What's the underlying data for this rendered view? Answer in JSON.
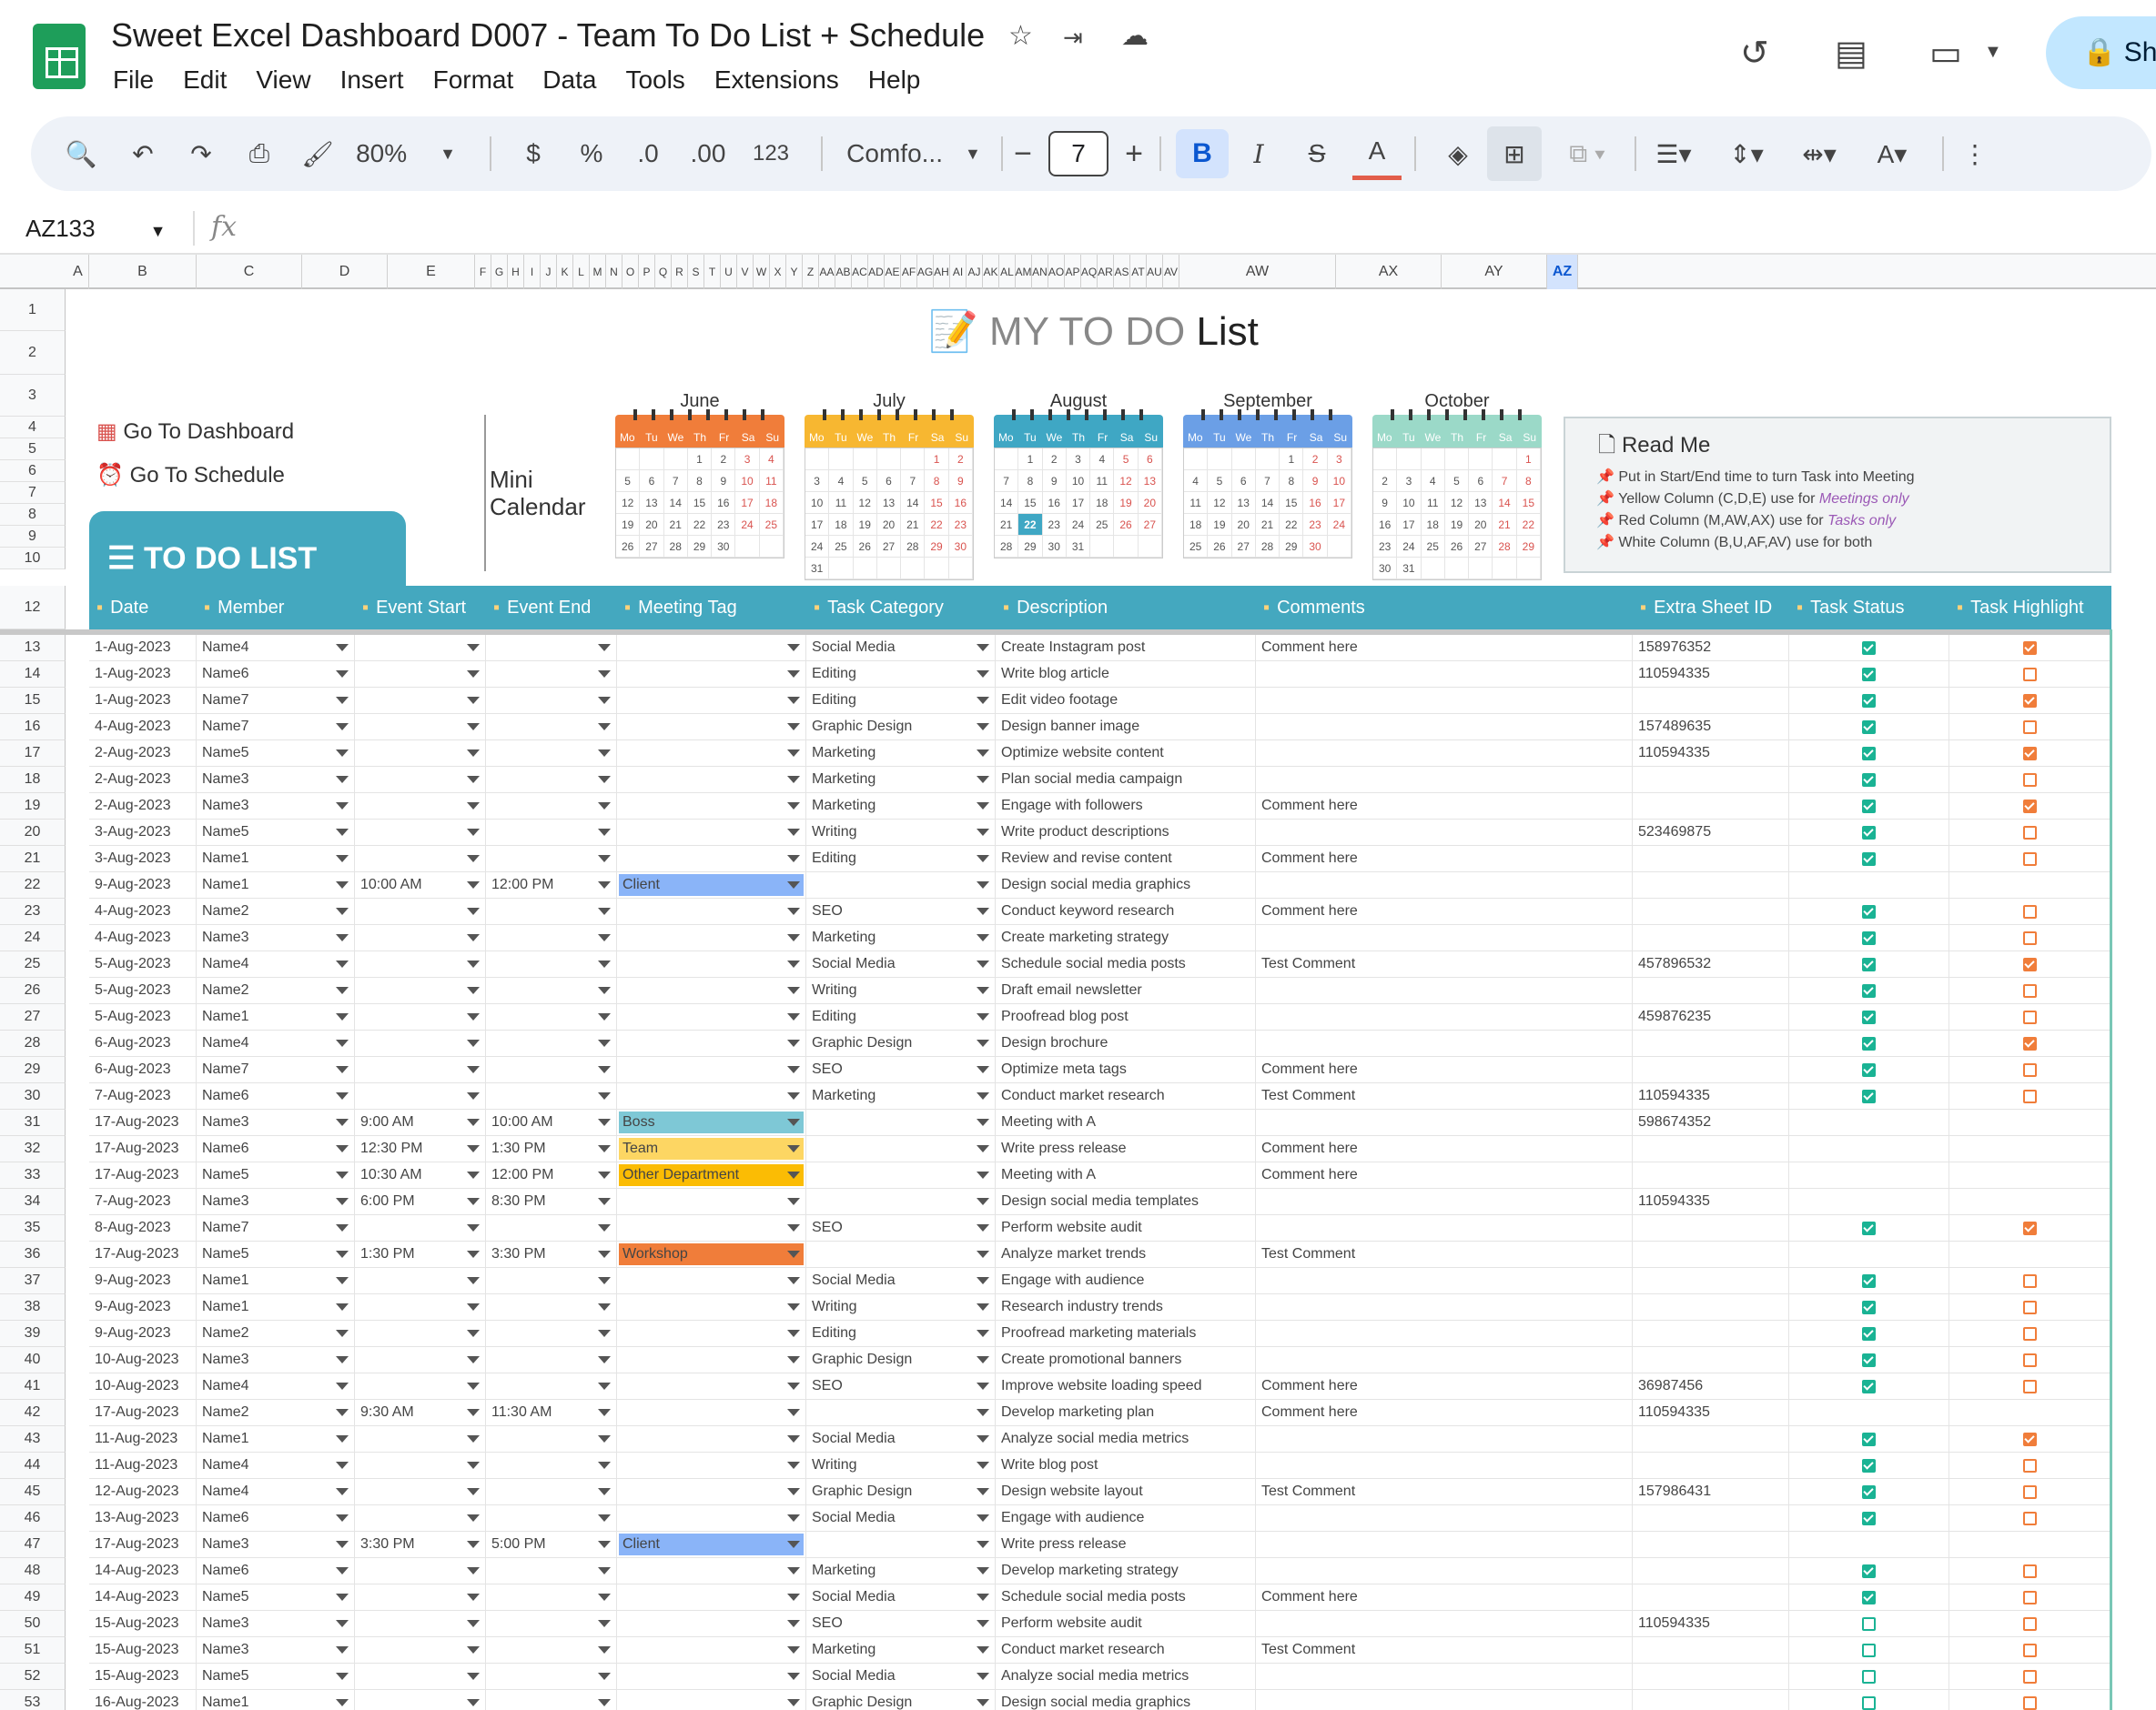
{
  "title": "Sweet Excel Dashboard D007 - Team To Do List + Schedule",
  "menu": [
    "File",
    "Edit",
    "View",
    "Insert",
    "Format",
    "Data",
    "Tools",
    "Extensions",
    "Help"
  ],
  "share_label": "Sh",
  "toolbar": {
    "zoom": "80%",
    "currency": "$",
    "percent": "%",
    "dec_dec": ".0",
    "inc_dec": ".00",
    "num_format": "123",
    "font": "Comfo...",
    "font_size": "7"
  },
  "name_box": "AZ133",
  "columns": [
    "A",
    "B",
    "C",
    "D",
    "E",
    "F",
    "G",
    "H",
    "I",
    "J",
    "K",
    "L",
    "M",
    "N",
    "O",
    "P",
    "Q",
    "R",
    "S",
    "T",
    "U",
    "V",
    "W",
    "X",
    "Y",
    "Z",
    "AA",
    "AB",
    "AC",
    "AD",
    "AE",
    "AF",
    "AG",
    "AH",
    "AI",
    "AJ",
    "AK",
    "AL",
    "AM",
    "AN",
    "AO",
    "AP",
    "AQ",
    "AR",
    "AS",
    "AT",
    "AU",
    "AV",
    "AW",
    "AX",
    "AY",
    "AZ"
  ],
  "sheet": {
    "title_light": "MY TO DO",
    "title_dark": "List",
    "nav_dashboard": "Go To Dashboard",
    "nav_schedule": "Go To Schedule",
    "mini_calendar": "Mini Calendar",
    "todo_tab": "TO DO LIST",
    "readme_title": "Read Me",
    "readme_lines": [
      "Put in Start/End time to turn Task into Meeting",
      "Yellow Column (C,D,E) use for ",
      "Red Column (M,AW,AX) use for ",
      "White Column (B,U,AF,AV) use for both"
    ],
    "readme_em": [
      "Meetings only",
      "Tasks only"
    ]
  },
  "weekdays": [
    "Mo",
    "Tu",
    "We",
    "Th",
    "Fr",
    "Sa",
    "Su"
  ],
  "calendars": [
    {
      "name": "June",
      "color": "#f07d3a",
      "offset": 3,
      "days": 30,
      "accent": "#d9534f"
    },
    {
      "name": "July",
      "color": "#f7b731",
      "offset": 5,
      "days": 31,
      "accent": "#d9534f"
    },
    {
      "name": "August",
      "color": "#3fa7c4",
      "offset": 1,
      "days": 31,
      "accent": "#d9534f",
      "today": 22
    },
    {
      "name": "September",
      "color": "#6b9fe6",
      "offset": 4,
      "days": 30,
      "accent": "#d9534f"
    },
    {
      "name": "October",
      "color": "#9bd9c8",
      "offset": 6,
      "days": 31,
      "accent": "#d9534f"
    }
  ],
  "headers": [
    "Date",
    "Member",
    "Event Start",
    "Event End",
    "Meeting Tag",
    "Task Category",
    "Description",
    "Comments",
    "Extra Sheet ID",
    "Task Status",
    "Task Highlight"
  ],
  "header_icons": [
    "calendar-icon",
    "member-icon",
    "alarm-icon",
    "alarm-icon",
    "tag-icon",
    "folder-icon",
    "pen-icon",
    "comment-icon",
    "sheet-icon",
    "checkbox-icon",
    "highlight-icon"
  ],
  "tag_colors": {
    "Client": "#8ab4f8",
    "Boss": "#7ec8d6",
    "Team": "#fdd663",
    "Other Department": "#fbbc04",
    "Workshop": "#f07d3a"
  },
  "rows": [
    {
      "n": 13,
      "date": "1-Aug-2023",
      "member": "Name4",
      "start": "",
      "end": "",
      "tag": "",
      "cat": "Social Media",
      "desc": "Create Instagram post",
      "comment": "Comment here",
      "id": "158976352",
      "status": "checked",
      "hl": "checked"
    },
    {
      "n": 14,
      "date": "1-Aug-2023",
      "member": "Name6",
      "start": "",
      "end": "",
      "tag": "",
      "cat": "Editing",
      "desc": "Write blog article",
      "comment": "",
      "id": "110594335",
      "status": "checked",
      "hl": "unchecked"
    },
    {
      "n": 15,
      "date": "1-Aug-2023",
      "member": "Name7",
      "start": "",
      "end": "",
      "tag": "",
      "cat": "Editing",
      "desc": "Edit video footage",
      "comment": "",
      "id": "",
      "status": "checked",
      "hl": "checked"
    },
    {
      "n": 16,
      "date": "4-Aug-2023",
      "member": "Name7",
      "start": "",
      "end": "",
      "tag": "",
      "cat": "Graphic Design",
      "desc": "Design banner image",
      "comment": "",
      "id": "157489635",
      "status": "checked",
      "hl": "unchecked"
    },
    {
      "n": 17,
      "date": "2-Aug-2023",
      "member": "Name5",
      "start": "",
      "end": "",
      "tag": "",
      "cat": "Marketing",
      "desc": "Optimize website content",
      "comment": "",
      "id": "110594335",
      "status": "checked",
      "hl": "checked"
    },
    {
      "n": 18,
      "date": "2-Aug-2023",
      "member": "Name3",
      "start": "",
      "end": "",
      "tag": "",
      "cat": "Marketing",
      "desc": "Plan social media campaign",
      "comment": "",
      "id": "",
      "status": "checked",
      "hl": "unchecked"
    },
    {
      "n": 19,
      "date": "2-Aug-2023",
      "member": "Name3",
      "start": "",
      "end": "",
      "tag": "",
      "cat": "Marketing",
      "desc": "Engage with followers",
      "comment": "Comment here",
      "id": "",
      "status": "checked",
      "hl": "checked"
    },
    {
      "n": 20,
      "date": "3-Aug-2023",
      "member": "Name5",
      "start": "",
      "end": "",
      "tag": "",
      "cat": "Writing",
      "desc": "Write product descriptions",
      "comment": "",
      "id": "523469875",
      "status": "checked",
      "hl": "unchecked"
    },
    {
      "n": 21,
      "date": "3-Aug-2023",
      "member": "Name1",
      "start": "",
      "end": "",
      "tag": "",
      "cat": "Editing",
      "desc": "Review and revise content",
      "comment": "Comment here",
      "id": "",
      "status": "checked",
      "hl": "unchecked"
    },
    {
      "n": 22,
      "date": "9-Aug-2023",
      "member": "Name1",
      "start": "10:00 AM",
      "end": "12:00 PM",
      "tag": "Client",
      "cat": "",
      "desc": "Design social media graphics",
      "comment": "",
      "id": "",
      "status": "",
      "hl": ""
    },
    {
      "n": 23,
      "date": "4-Aug-2023",
      "member": "Name2",
      "start": "",
      "end": "",
      "tag": "",
      "cat": "SEO",
      "desc": "Conduct keyword research",
      "comment": "Comment here",
      "id": "",
      "status": "checked",
      "hl": "unchecked"
    },
    {
      "n": 24,
      "date": "4-Aug-2023",
      "member": "Name3",
      "start": "",
      "end": "",
      "tag": "",
      "cat": "Marketing",
      "desc": "Create marketing strategy",
      "comment": "",
      "id": "",
      "status": "checked",
      "hl": "unchecked"
    },
    {
      "n": 25,
      "date": "5-Aug-2023",
      "member": "Name4",
      "start": "",
      "end": "",
      "tag": "",
      "cat": "Social Media",
      "desc": "Schedule social media posts",
      "comment": "Test Comment",
      "id": "457896532",
      "status": "checked",
      "hl": "checked"
    },
    {
      "n": 26,
      "date": "5-Aug-2023",
      "member": "Name2",
      "start": "",
      "end": "",
      "tag": "",
      "cat": "Writing",
      "desc": "Draft email newsletter",
      "comment": "",
      "id": "",
      "status": "checked",
      "hl": "unchecked"
    },
    {
      "n": 27,
      "date": "5-Aug-2023",
      "member": "Name1",
      "start": "",
      "end": "",
      "tag": "",
      "cat": "Editing",
      "desc": "Proofread blog post",
      "comment": "",
      "id": "459876235",
      "status": "checked",
      "hl": "unchecked"
    },
    {
      "n": 28,
      "date": "6-Aug-2023",
      "member": "Name4",
      "start": "",
      "end": "",
      "tag": "",
      "cat": "Graphic Design",
      "desc": "Design brochure",
      "comment": "",
      "id": "",
      "status": "checked",
      "hl": "checked"
    },
    {
      "n": 29,
      "date": "6-Aug-2023",
      "member": "Name7",
      "start": "",
      "end": "",
      "tag": "",
      "cat": "SEO",
      "desc": "Optimize meta tags",
      "comment": "Comment here",
      "id": "",
      "status": "checked",
      "hl": "unchecked"
    },
    {
      "n": 30,
      "date": "7-Aug-2023",
      "member": "Name6",
      "start": "",
      "end": "",
      "tag": "",
      "cat": "Marketing",
      "desc": "Conduct market research",
      "comment": "Test Comment",
      "id": "110594335",
      "status": "checked",
      "hl": "unchecked"
    },
    {
      "n": 31,
      "date": "17-Aug-2023",
      "member": "Name3",
      "start": "9:00 AM",
      "end": "10:00 AM",
      "tag": "Boss",
      "cat": "",
      "desc": "Meeting with A",
      "comment": "",
      "id": "598674352",
      "status": "",
      "hl": ""
    },
    {
      "n": 32,
      "date": "17-Aug-2023",
      "member": "Name6",
      "start": "12:30 PM",
      "end": "1:30 PM",
      "tag": "Team",
      "cat": "",
      "desc": "Write press release",
      "comment": "Comment here",
      "id": "",
      "status": "",
      "hl": ""
    },
    {
      "n": 33,
      "date": "17-Aug-2023",
      "member": "Name5",
      "start": "10:30 AM",
      "end": "12:00 PM",
      "tag": "Other Department",
      "cat": "",
      "desc": "Meeting with A",
      "comment": "Comment here",
      "id": "",
      "status": "",
      "hl": ""
    },
    {
      "n": 34,
      "date": "7-Aug-2023",
      "member": "Name3",
      "start": "6:00 PM",
      "end": "8:30 PM",
      "tag": "",
      "cat": "",
      "desc": "Design social media templates",
      "comment": "",
      "id": "110594335",
      "status": "",
      "hl": ""
    },
    {
      "n": 35,
      "date": "8-Aug-2023",
      "member": "Name7",
      "start": "",
      "end": "",
      "tag": "",
      "cat": "SEO",
      "desc": "Perform website audit",
      "comment": "",
      "id": "",
      "status": "checked",
      "hl": "checked"
    },
    {
      "n": 36,
      "date": "17-Aug-2023",
      "member": "Name5",
      "start": "1:30 PM",
      "end": "3:30 PM",
      "tag": "Workshop",
      "cat": "",
      "desc": "Analyze market trends",
      "comment": "Test Comment",
      "id": "",
      "status": "",
      "hl": ""
    },
    {
      "n": 37,
      "date": "9-Aug-2023",
      "member": "Name1",
      "start": "",
      "end": "",
      "tag": "",
      "cat": "Social Media",
      "desc": "Engage with audience",
      "comment": "",
      "id": "",
      "status": "checked",
      "hl": "unchecked"
    },
    {
      "n": 38,
      "date": "9-Aug-2023",
      "member": "Name1",
      "start": "",
      "end": "",
      "tag": "",
      "cat": "Writing",
      "desc": "Research industry trends",
      "comment": "",
      "id": "",
      "status": "checked",
      "hl": "unchecked"
    },
    {
      "n": 39,
      "date": "9-Aug-2023",
      "member": "Name2",
      "start": "",
      "end": "",
      "tag": "",
      "cat": "Editing",
      "desc": "Proofread marketing materials",
      "comment": "",
      "id": "",
      "status": "checked",
      "hl": "unchecked"
    },
    {
      "n": 40,
      "date": "10-Aug-2023",
      "member": "Name3",
      "start": "",
      "end": "",
      "tag": "",
      "cat": "Graphic Design",
      "desc": "Create promotional banners",
      "comment": "",
      "id": "",
      "status": "checked",
      "hl": "unchecked"
    },
    {
      "n": 41,
      "date": "10-Aug-2023",
      "member": "Name4",
      "start": "",
      "end": "",
      "tag": "",
      "cat": "SEO",
      "desc": "Improve website loading speed",
      "comment": "Comment here",
      "id": "36987456",
      "status": "checked",
      "hl": "unchecked"
    },
    {
      "n": 42,
      "date": "17-Aug-2023",
      "member": "Name2",
      "start": "9:30 AM",
      "end": "11:30 AM",
      "tag": "",
      "cat": "",
      "desc": "Develop marketing plan",
      "comment": "Comment here",
      "id": "110594335",
      "status": "",
      "hl": ""
    },
    {
      "n": 43,
      "date": "11-Aug-2023",
      "member": "Name1",
      "start": "",
      "end": "",
      "tag": "",
      "cat": "Social Media",
      "desc": "Analyze social media metrics",
      "comment": "",
      "id": "",
      "status": "checked",
      "hl": "checked"
    },
    {
      "n": 44,
      "date": "11-Aug-2023",
      "member": "Name4",
      "start": "",
      "end": "",
      "tag": "",
      "cat": "Writing",
      "desc": "Write blog post",
      "comment": "",
      "id": "",
      "status": "checked",
      "hl": "unchecked"
    },
    {
      "n": 45,
      "date": "12-Aug-2023",
      "member": "Name4",
      "start": "",
      "end": "",
      "tag": "",
      "cat": "Graphic Design",
      "desc": "Design website layout",
      "comment": "Test Comment",
      "id": "157986431",
      "status": "checked",
      "hl": "unchecked"
    },
    {
      "n": 46,
      "date": "13-Aug-2023",
      "member": "Name6",
      "start": "",
      "end": "",
      "tag": "",
      "cat": "Social Media",
      "desc": "Engage with audience",
      "comment": "",
      "id": "",
      "status": "checked",
      "hl": "unchecked"
    },
    {
      "n": 47,
      "date": "17-Aug-2023",
      "member": "Name3",
      "start": "3:30 PM",
      "end": "5:00 PM",
      "tag": "Client",
      "cat": "",
      "desc": "Write press release",
      "comment": "",
      "id": "",
      "status": "",
      "hl": ""
    },
    {
      "n": 48,
      "date": "14-Aug-2023",
      "member": "Name6",
      "start": "",
      "end": "",
      "tag": "",
      "cat": "Marketing",
      "desc": "Develop marketing strategy",
      "comment": "",
      "id": "",
      "status": "checked",
      "hl": "unchecked"
    },
    {
      "n": 49,
      "date": "14-Aug-2023",
      "member": "Name5",
      "start": "",
      "end": "",
      "tag": "",
      "cat": "Social Media",
      "desc": "Schedule social media posts",
      "comment": "Comment here",
      "id": "",
      "status": "checked",
      "hl": "unchecked"
    },
    {
      "n": 50,
      "date": "15-Aug-2023",
      "member": "Name3",
      "start": "",
      "end": "",
      "tag": "",
      "cat": "SEO",
      "desc": "Perform website audit",
      "comment": "",
      "id": "110594335",
      "status": "unchecked",
      "hl": "unchecked"
    },
    {
      "n": 51,
      "date": "15-Aug-2023",
      "member": "Name3",
      "start": "",
      "end": "",
      "tag": "",
      "cat": "Marketing",
      "desc": "Conduct market research",
      "comment": "Test Comment",
      "id": "",
      "status": "unchecked",
      "hl": "unchecked"
    },
    {
      "n": 52,
      "date": "15-Aug-2023",
      "member": "Name5",
      "start": "",
      "end": "",
      "tag": "",
      "cat": "Social Media",
      "desc": "Analyze social media metrics",
      "comment": "",
      "id": "",
      "status": "unchecked",
      "hl": "unchecked"
    },
    {
      "n": 53,
      "date": "16-Aug-2023",
      "member": "Name1",
      "start": "",
      "end": "",
      "tag": "",
      "cat": "Graphic Design",
      "desc": "Design social media graphics",
      "comment": "",
      "id": "",
      "status": "unchecked",
      "hl": "unchecked"
    }
  ]
}
